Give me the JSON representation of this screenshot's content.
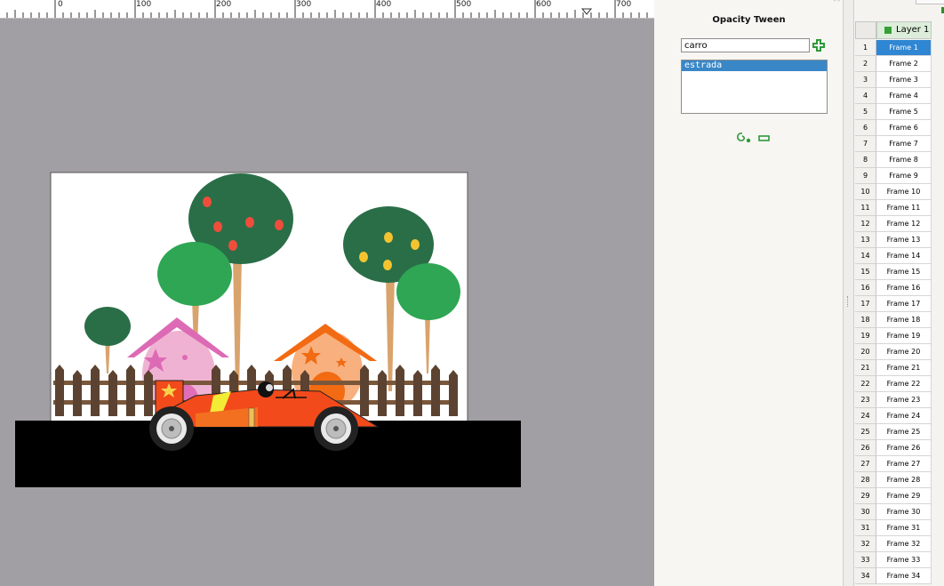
{
  "ruler": {
    "labels": [
      "0",
      "100",
      "200",
      "300",
      "400",
      "500",
      "600",
      "700"
    ]
  },
  "tween_panel": {
    "title": "Opacity Tween",
    "object_input_value": "carro",
    "add_icon": "plus-icon",
    "objects": [
      "estrada"
    ],
    "selected_object": "estrada",
    "action_icons": [
      "tween-loop-icon",
      "remove-icon"
    ]
  },
  "timeline": {
    "layer_name": "Layer 1",
    "layer_color": "#35a035",
    "selected_frame": 1,
    "frames": [
      {
        "index": "1",
        "label": "Frame 1"
      },
      {
        "index": "2",
        "label": "Frame 2"
      },
      {
        "index": "3",
        "label": "Frame 3"
      },
      {
        "index": "4",
        "label": "Frame 4"
      },
      {
        "index": "5",
        "label": "Frame 5"
      },
      {
        "index": "6",
        "label": "Frame 6"
      },
      {
        "index": "7",
        "label": "Frame 7"
      },
      {
        "index": "8",
        "label": "Frame 8"
      },
      {
        "index": "9",
        "label": "Frame 9"
      },
      {
        "index": "10",
        "label": "Frame 10"
      },
      {
        "index": "11",
        "label": "Frame 11"
      },
      {
        "index": "12",
        "label": "Frame 12"
      },
      {
        "index": "13",
        "label": "Frame 13"
      },
      {
        "index": "14",
        "label": "Frame 14"
      },
      {
        "index": "15",
        "label": "Frame 15"
      },
      {
        "index": "16",
        "label": "Frame 16"
      },
      {
        "index": "17",
        "label": "Frame 17"
      },
      {
        "index": "18",
        "label": "Frame 18"
      },
      {
        "index": "19",
        "label": "Frame 19"
      },
      {
        "index": "20",
        "label": "Frame 20"
      },
      {
        "index": "21",
        "label": "Frame 21"
      },
      {
        "index": "22",
        "label": "Frame 22"
      },
      {
        "index": "23",
        "label": "Frame 23"
      },
      {
        "index": "24",
        "label": "Frame 24"
      },
      {
        "index": "25",
        "label": "Frame 25"
      },
      {
        "index": "26",
        "label": "Frame 26"
      },
      {
        "index": "27",
        "label": "Frame 27"
      },
      {
        "index": "28",
        "label": "Frame 28"
      },
      {
        "index": "29",
        "label": "Frame 29"
      },
      {
        "index": "30",
        "label": "Frame 30"
      },
      {
        "index": "31",
        "label": "Frame 31"
      },
      {
        "index": "32",
        "label": "Frame 32"
      },
      {
        "index": "33",
        "label": "Frame 33"
      },
      {
        "index": "34",
        "label": "Frame 34"
      }
    ]
  },
  "colors": {
    "workspace": "#a19fa4",
    "selection": "#2f86d3",
    "accent_green": "#2c9a3a"
  }
}
